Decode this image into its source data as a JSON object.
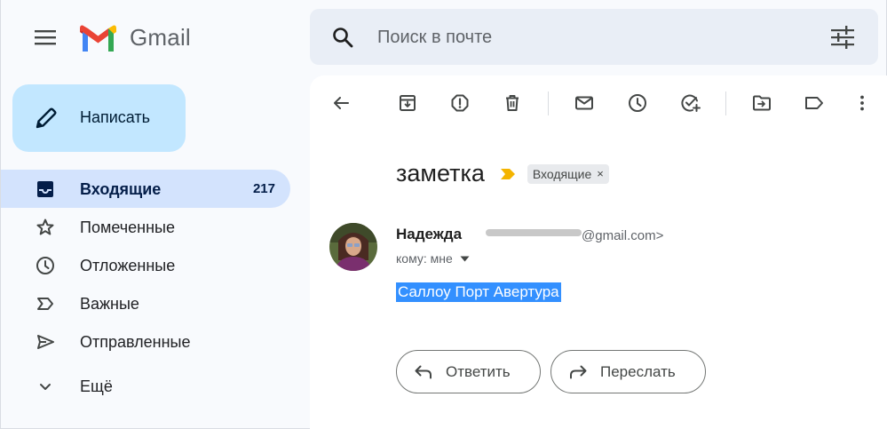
{
  "app": {
    "name": "Gmail"
  },
  "search": {
    "placeholder": "Поиск в почте"
  },
  "compose": {
    "label": "Написать"
  },
  "sidebar": {
    "items": [
      {
        "id": "inbox",
        "label": "Входящие",
        "count": "217",
        "icon": "inbox-icon",
        "active": true
      },
      {
        "id": "starred",
        "label": "Помеченные",
        "icon": "star-icon"
      },
      {
        "id": "snoozed",
        "label": "Отложенные",
        "icon": "clock-icon"
      },
      {
        "id": "important",
        "label": "Важные",
        "icon": "important-icon"
      },
      {
        "id": "sent",
        "label": "Отправленные",
        "icon": "send-icon"
      },
      {
        "id": "more",
        "label": "Ещё",
        "icon": "chevron-down-icon"
      }
    ]
  },
  "toolbar": {
    "icons": [
      "back-arrow-icon",
      "archive-icon",
      "report-spam-icon",
      "delete-icon",
      "mark-unread-icon",
      "snooze-icon",
      "add-to-tasks-icon",
      "move-to-icon",
      "label-icon",
      "more-vert-icon"
    ]
  },
  "message": {
    "subject": "заметка",
    "label_chip": "Входящие",
    "label_chip_close": "×",
    "sender_name": "Надежда",
    "sender_email": "@gmail.com>",
    "recipient": "кому: мне",
    "body": "Саллоу Порт Авертура"
  },
  "actions": {
    "reply": "Ответить",
    "forward": "Переслать"
  },
  "colors": {
    "background": "#f8fafd",
    "search_bg": "#e9eef6",
    "compose_bg": "#c2e7ff",
    "active_nav_bg": "#d3e3fd",
    "important_marker": "#f4b400",
    "selection": "#3390ff"
  }
}
